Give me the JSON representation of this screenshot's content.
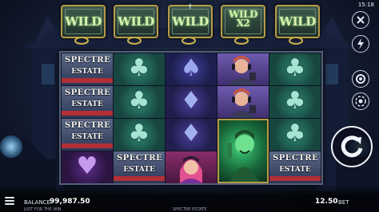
{
  "status_bar": {
    "time": "15:18"
  },
  "wild_row": [
    {
      "label": "WILD"
    },
    {
      "label": "WILD"
    },
    {
      "label": "WILD"
    },
    {
      "label": "WILD",
      "multiplier": "X2"
    },
    {
      "label": "WILD"
    }
  ],
  "reels": {
    "logo_text_line1": "SPECTRE",
    "logo_text_line2": "ESTATE",
    "symbols": [
      [
        "logo",
        "club",
        "spade",
        "character",
        "club"
      ],
      [
        "logo",
        "club",
        "diamond",
        "character",
        "club"
      ],
      [
        "logo",
        "club",
        "diamond",
        "man-wild",
        "club"
      ],
      [
        "heart",
        "logo",
        "girl",
        "man-wild",
        "logo"
      ]
    ]
  },
  "footer": {
    "balance_label": "BALANCE",
    "balance_value": "99,987.50",
    "bet_value": "12.50",
    "bet_label": "BET",
    "tagline": "JUST FOR THE WIN",
    "game_name": "SPECTRE ESTATE"
  },
  "colors": {
    "frame_gold": "#b79a46",
    "wild_glow": "#d9f1b0",
    "ribbon_red": "#b22f36"
  },
  "icons": [
    "close-icon",
    "lightning-icon",
    "settings-gear-icon",
    "autoplay-icon",
    "spin-icon",
    "menu-icon"
  ]
}
